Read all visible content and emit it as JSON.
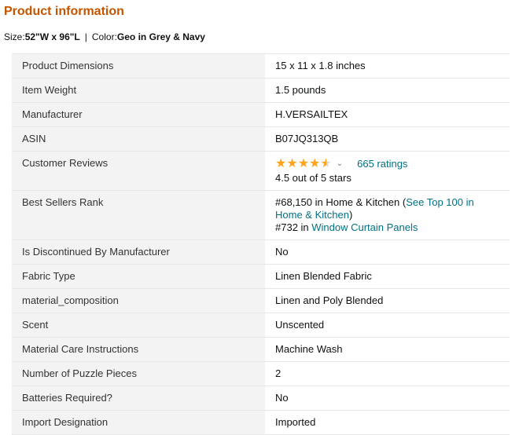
{
  "section": {
    "title": "Product information"
  },
  "variation": {
    "size_label": "Size:",
    "size_value": "52\"W x 96\"L",
    "separator": "|",
    "color_label": "Color:",
    "color_value": "Geo in Grey & Navy"
  },
  "specs": {
    "dimensions": {
      "label": "Product Dimensions",
      "value": "15 x 11 x 1.8 inches"
    },
    "weight": {
      "label": "Item Weight",
      "value": "1.5 pounds"
    },
    "manufacturer": {
      "label": "Manufacturer",
      "value": "H.VERSAILTEX"
    },
    "asin": {
      "label": "ASIN",
      "value": "B07JQ313QB"
    },
    "reviews": {
      "label": "Customer Reviews",
      "rating": 4.5,
      "ratings_link": "665 ratings",
      "summary": "4.5 out of 5 stars",
      "star_icon": "star-icon",
      "star_color": "#ffa41c"
    },
    "rank": {
      "label": "Best Sellers Rank",
      "line1_prefix": "#68,150 in Home & Kitchen (",
      "line1_link": "See Top 100 in Home & Kitchen",
      "line1_suffix": ")",
      "line2_prefix": "#732 in ",
      "line2_link": "Window Curtain Panels"
    },
    "discontinued": {
      "label": "Is Discontinued By Manufacturer",
      "value": "No"
    },
    "fabric": {
      "label": "Fabric Type",
      "value": "Linen Blended Fabric"
    },
    "material": {
      "label": "material_composition",
      "value": "Linen and Poly Blended"
    },
    "scent": {
      "label": "Scent",
      "value": "Unscented"
    },
    "care": {
      "label": "Material Care Instructions",
      "value": "Machine Wash"
    },
    "puzzle": {
      "label": "Number of Puzzle Pieces",
      "value": "2"
    },
    "batteries": {
      "label": "Batteries Required?",
      "value": "No"
    },
    "import": {
      "label": "Import Designation",
      "value": "Imported"
    }
  },
  "colors": {
    "heading": "#c45500",
    "link": "#007185",
    "label_background": "#f3f3f3",
    "row_border": "#e7e7e7"
  }
}
